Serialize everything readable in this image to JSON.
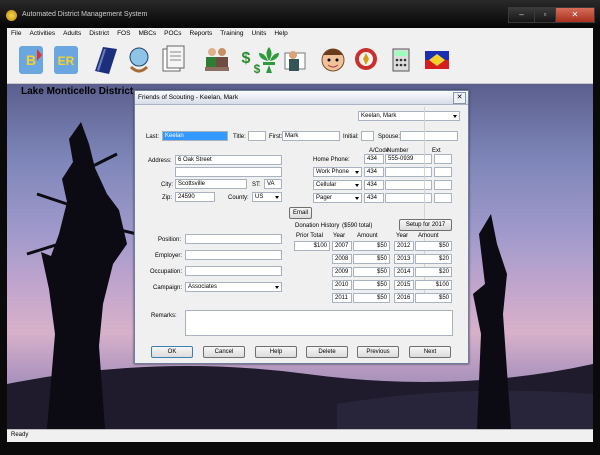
{
  "window": {
    "title": "Automated District Management System",
    "min": "–",
    "max": "▫",
    "close": "✕"
  },
  "menu": [
    "File",
    "Activities",
    "Adults",
    "District",
    "FOS",
    "MBCs",
    "POCs",
    "Reports",
    "Training",
    "Units",
    "Help"
  ],
  "toolbar_icons": [
    "be-icon",
    "er-icon",
    "book-icon",
    "globe-hands-icon",
    "documents-icon",
    "meeting-icon",
    "money-icon",
    "fleur-de-lis-icon",
    "handshake-icon",
    "scout-face-icon",
    "trophy-icon",
    "calculator-icon",
    "flag-icon"
  ],
  "desktop": {
    "district": "Lake Monticello District"
  },
  "status": "Ready",
  "dialog": {
    "title": "Friends of Scouting - Keelan,  Mark",
    "close": "✕",
    "person_select": "Keelan,  Mark",
    "labels": {
      "last": "Last:",
      "title": "Title:",
      "first": "First:",
      "initial": "Initial:",
      "spouse": "Spouse:",
      "address": "Address:",
      "city": "City:",
      "st": "ST:",
      "zip": "Zip:",
      "county": "County:",
      "acode": "A/Code",
      "number": "Number",
      "ext": "Ext",
      "home_phone": "Home Phone:",
      "position": "Position:",
      "employer": "Employer:",
      "occupation": "Occupation:",
      "campaign": "Campaign:",
      "remarks": "Remarks:",
      "donation_history": "Donation History",
      "donation_total": "($590 total)",
      "prior_total": "Prior Total",
      "year": "Year",
      "amount": "Amount"
    },
    "values": {
      "last": "Keelan",
      "title": "",
      "first": "Mark",
      "initial": "",
      "spouse": "",
      "address1": "6 Oak Street",
      "address2": "",
      "city": "Scottsville",
      "st": "VA",
      "zip": "24590",
      "county": "US",
      "position": "",
      "employer": "",
      "occupation": "",
      "campaign": "Associates",
      "remarks": "",
      "prior_total": "$100"
    },
    "phones": [
      {
        "label": "Home Phone:",
        "acode": "434",
        "number": "555-0939",
        "ext": ""
      },
      {
        "label": "Work Phone",
        "acode": "434",
        "number": "",
        "ext": ""
      },
      {
        "label": "Cellular",
        "acode": "434",
        "number": "",
        "ext": ""
      },
      {
        "label": "Pager",
        "acode": "434",
        "number": "",
        "ext": ""
      }
    ],
    "donations_left": [
      {
        "year": "2007",
        "amount": "$50"
      },
      {
        "year": "2008",
        "amount": "$50"
      },
      {
        "year": "2009",
        "amount": "$50"
      },
      {
        "year": "2010",
        "amount": "$50"
      },
      {
        "year": "2011",
        "amount": "$50"
      }
    ],
    "donations_right": [
      {
        "year": "2012",
        "amount": "$50"
      },
      {
        "year": "2013",
        "amount": "$20"
      },
      {
        "year": "2014",
        "amount": "$20"
      },
      {
        "year": "2015",
        "amount": "$100"
      },
      {
        "year": "2016",
        "amount": "$50"
      }
    ],
    "buttons": {
      "email": "Email",
      "setup": "Setup for 2017",
      "ok": "OK",
      "cancel": "Cancel",
      "help": "Help",
      "delete": "Delete",
      "previous": "Previous",
      "next": "Next"
    }
  }
}
